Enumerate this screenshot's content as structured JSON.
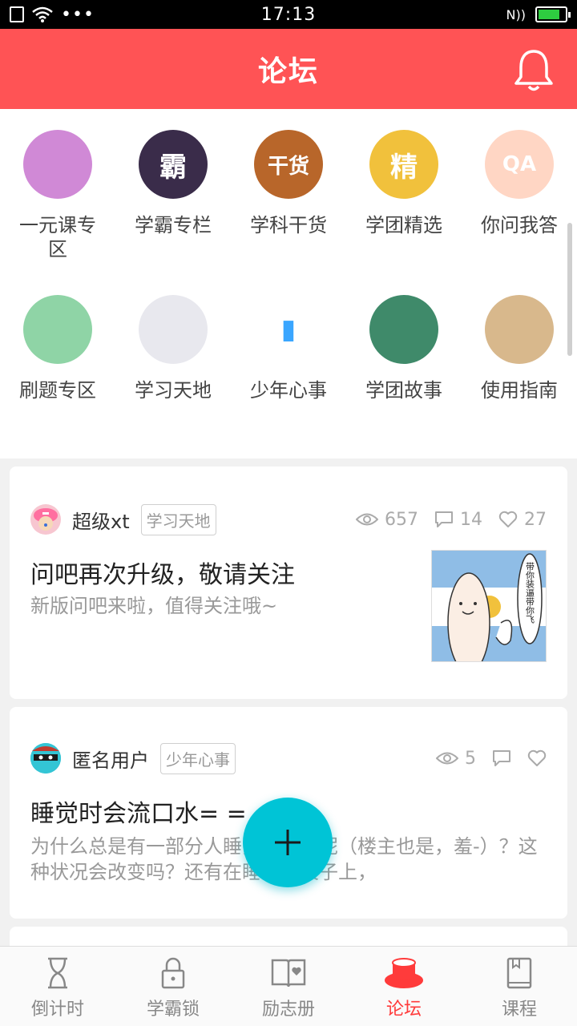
{
  "status_bar": {
    "time": "17:13",
    "battery_level": 0.8
  },
  "header": {
    "title": "论坛"
  },
  "categories": [
    {
      "label": "一元课专区",
      "icon": "person-avatar-icon",
      "color": "#d089d6"
    },
    {
      "label": "学霸专栏",
      "icon": "xueba-badge-icon",
      "color": "#3a2c4a",
      "glyph": "霸"
    },
    {
      "label": "学科干货",
      "icon": "dry-goods-icon",
      "color": "#b8662a",
      "glyph": "干货"
    },
    {
      "label": "学团精选",
      "icon": "select-badge-icon",
      "color": "#f1c13c",
      "glyph": "精"
    },
    {
      "label": "你问我答",
      "icon": "qa-icon",
      "color": "#ffd6c4",
      "glyph": "QA"
    },
    {
      "label": "刷题专区",
      "icon": "exercise-icon",
      "color": "#8fd4a6"
    },
    {
      "label": "学习天地",
      "icon": "magnet-icon",
      "color": "#e8e8ee"
    },
    {
      "label": "少年心事",
      "icon": "popsicle-icon",
      "color": "#ffffff"
    },
    {
      "label": "学团故事",
      "icon": "book-icon",
      "color": "#3f8a6a"
    },
    {
      "label": "使用指南",
      "icon": "chess-icon",
      "color": "#d8b88c"
    }
  ],
  "posts": [
    {
      "author": "超级xt",
      "tag": "学习天地",
      "views": "657",
      "comments": "14",
      "likes": "27",
      "title": "问吧再次升级，敬请关注",
      "summary": "新版问吧来啦，值得关注哦~",
      "thumbnail_text": "带你装逼带你飞"
    },
    {
      "author": "匿名用户",
      "tag": "少年心事",
      "views": "5",
      "comments": "",
      "likes": "",
      "title": "睡觉时会流口水= =",
      "summary": "为什么总是有一部分人睡觉流口水呢（楼主也是，羞-）？这种状况会改变吗？还有在睡趴在桌子上，"
    }
  ],
  "bottom_nav": [
    {
      "label": "倒计时",
      "icon": "hourglass-icon",
      "active": false
    },
    {
      "label": "学霸锁",
      "icon": "lock-icon",
      "active": false
    },
    {
      "label": "励志册",
      "icon": "book-heart-icon",
      "active": false
    },
    {
      "label": "论坛",
      "icon": "forum-cup-icon",
      "active": true
    },
    {
      "label": "课程",
      "icon": "course-book-icon",
      "active": false
    }
  ],
  "colors": {
    "header": "#ff5355",
    "fab": "#00c4d6",
    "active": "#ff3b3b"
  }
}
